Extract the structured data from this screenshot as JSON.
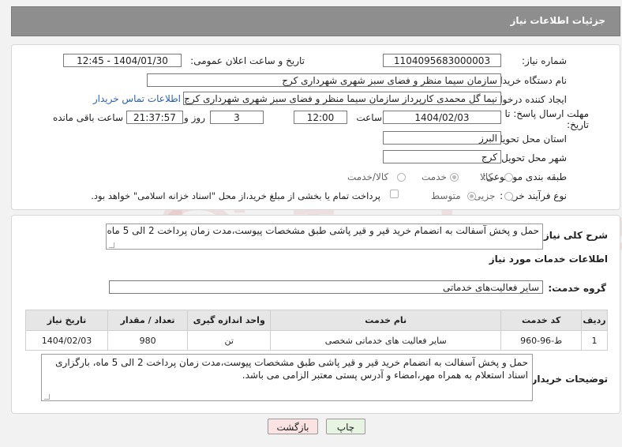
{
  "header": {
    "title": "جزئیات اطلاعات نیاز"
  },
  "form": {
    "need_number_label": "شماره نیاز:",
    "need_number_value": "1104095683000003",
    "announce_label": "تاریخ و ساعت اعلان عمومی:",
    "announce_value": "1404/01/30 - 12:45",
    "buyer_org_label": "نام دستگاه خریدار:",
    "buyer_org_value": "سازمان سیما منظر و فضای سبز شهری شهرداری کرج",
    "creator_label": "ایجاد کننده درخواست:",
    "creator_value": "نیما گل محمدی کارپرداز سازمان سیما منظر و فضای سبز شهری شهرداری کرج",
    "contact_link": "اطلاعات تماس خریدار",
    "deadline_label_1": "مهلت ارسال پاسخ: تا",
    "deadline_label_2": "تاریخ:",
    "deadline_date": "1404/02/03",
    "time_label": "ساعت",
    "deadline_time": "12:00",
    "days_value": "3",
    "days_label": "روز و",
    "remaining_value": "21:37:57",
    "remaining_label": "ساعت باقی مانده",
    "province_label": "استان محل تحویل:",
    "province_value": "البرز",
    "city_label": "شهر محل تحویل:",
    "city_value": "کرج",
    "category_label": "طبقه بندی موضوعی:",
    "category_options": [
      "کالا",
      "خدمت",
      "کالا/خدمت"
    ],
    "category_selected": "خدمت",
    "process_label": "نوع فرآیند خرید :",
    "process_options": [
      "جزیی",
      "متوسط"
    ],
    "process_selected": "متوسط",
    "payment_note": "پرداخت تمام یا بخشی از مبلغ خرید،از محل \"اسناد خزانه اسلامی\" خواهد بود."
  },
  "summary": {
    "label": "شرح کلی نیاز:",
    "value": "حمل و پخش آسفالت به انضمام خرید قیر و قیر پاشی طبق مشخصات پیوست،مدت زمان پرداخت 2 الی 5 ماه"
  },
  "services": {
    "title": "اطلاعات خدمات مورد نیاز",
    "group_label": "گروه خدمت:",
    "group_value": "سایر فعالیت‌های خدماتی",
    "columns": [
      "ردیف",
      "کد خدمت",
      "نام خدمت",
      "واحد اندازه گیری",
      "تعداد / مقدار",
      "تاریخ نیاز"
    ],
    "rows": [
      [
        "1",
        "ط-96-960",
        "سایر فعالیت های خدماتی شخصی",
        "تن",
        "980",
        "1404/02/03"
      ]
    ]
  },
  "buyer_notes": {
    "label": "توضیحات خریدار:",
    "value": "حمل و پخش آسفالت به انضمام خرید قیر و قیر پاشی طبق مشخصات پیوست،مدت زمان پرداخت 2 الی 5 ماه، بارگزاری اسناد استعلام به همراه مهر،امضاء و آدرس پستی معتبر الزامی می باشد."
  },
  "buttons": {
    "print": "چاپ",
    "back": "بازگشت"
  },
  "watermark": "AriaTender.neT",
  "colors": {
    "header": "#8e8e8e",
    "link": "#2a62b0",
    "back_button": "#fbe3e3",
    "print_button": "#e6f4e1"
  }
}
